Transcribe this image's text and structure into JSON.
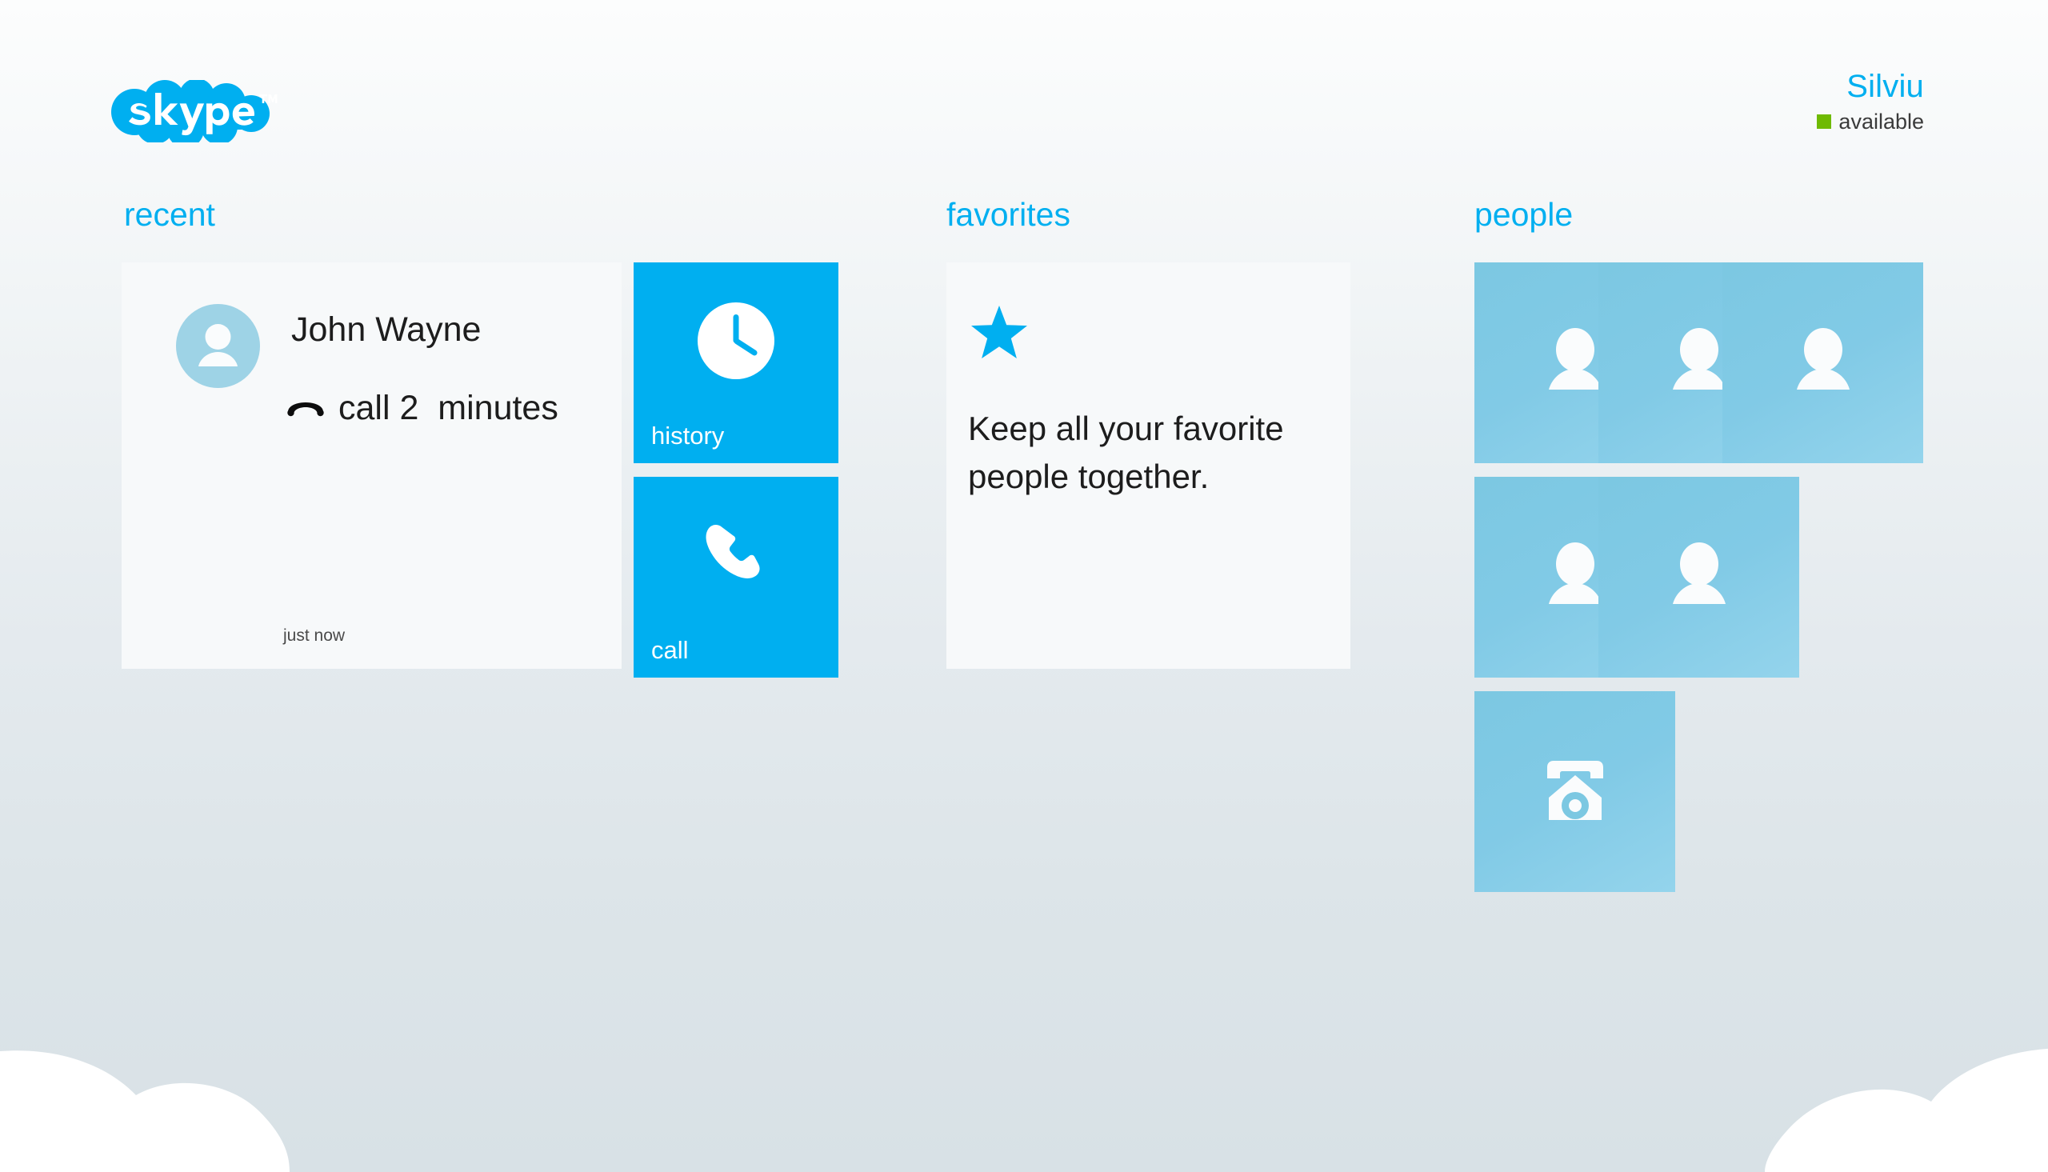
{
  "app": {
    "name": "Skype",
    "logo_wordmark": "skype",
    "logo_trademark": "TM"
  },
  "header": {
    "user_name": "Silviu",
    "status_label": "available",
    "status_color": "#6fba02",
    "status_icon": "status-square-icon"
  },
  "colors": {
    "brand_blue": "#00aff0",
    "tile_light": "#f7f9fa",
    "people_tile": "#81cae6",
    "background_top": "#fcfdfd",
    "background_bottom": "#d8e1e6",
    "text_dark": "#1d1d1d",
    "status_green": "#6fba02"
  },
  "sections": {
    "recent": {
      "title": "recent"
    },
    "favorites": {
      "title": "favorites"
    },
    "people": {
      "title": "people"
    }
  },
  "recent": {
    "contact_name": "John Wayne",
    "avatar_icon": "person-avatar-icon",
    "call_icon": "call-ended-icon",
    "call_text": "call 2  minutes",
    "timestamp": "just now"
  },
  "actions": [
    {
      "label": "history",
      "icon": "clock-icon"
    },
    {
      "label": "call",
      "icon": "phone-handset-icon"
    }
  ],
  "favorites": {
    "icon": "star-icon",
    "message": "Keep all your favorite people together."
  },
  "people": {
    "tiles": [
      {
        "icon": "person-silhouette-icon",
        "row": 0,
        "col": 0
      },
      {
        "icon": "person-silhouette-icon",
        "row": 0,
        "col": 1
      },
      {
        "icon": "person-silhouette-icon",
        "row": 0,
        "col": 2
      },
      {
        "icon": "person-silhouette-icon",
        "row": 1,
        "col": 0
      },
      {
        "icon": "person-silhouette-icon",
        "row": 1,
        "col": 1
      },
      {
        "icon": "desk-phone-icon",
        "row": 2,
        "col": 0
      }
    ]
  }
}
